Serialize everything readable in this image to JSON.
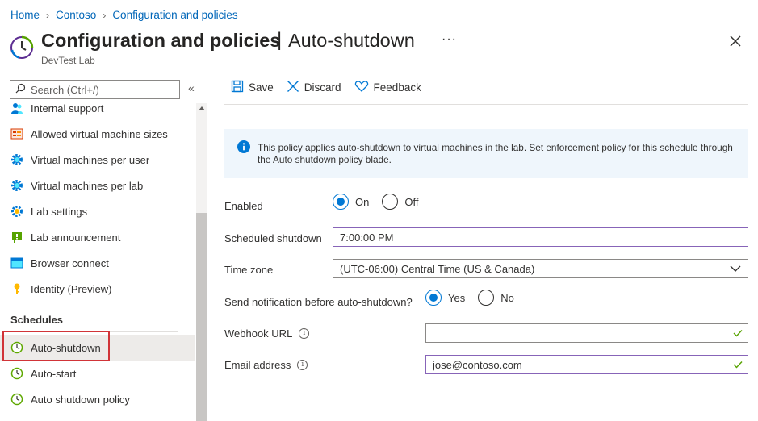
{
  "breadcrumb": [
    "Home",
    "Contoso",
    "Configuration and policies"
  ],
  "header": {
    "title": "Configuration and policies",
    "separator": "|",
    "subtitle": "Auto-shutdown",
    "resource_type": "DevTest Lab",
    "more": "···"
  },
  "sidebar": {
    "search_placeholder": "Search (Ctrl+/)",
    "collapse_glyph": "«",
    "items": [
      {
        "label": "Internal support",
        "icon": "support-icon"
      },
      {
        "label": "Allowed virtual machine sizes",
        "icon": "vm-sizes-icon"
      },
      {
        "label": "Virtual machines per user",
        "icon": "gear-icon"
      },
      {
        "label": "Virtual machines per lab",
        "icon": "gear-icon"
      },
      {
        "label": "Lab settings",
        "icon": "settings-icon"
      },
      {
        "label": "Lab announcement",
        "icon": "announcement-icon"
      },
      {
        "label": "Browser connect",
        "icon": "browser-icon"
      },
      {
        "label": "Identity (Preview)",
        "icon": "key-icon"
      }
    ],
    "section_header": "Schedules",
    "schedule_items": [
      {
        "label": "Auto-shutdown",
        "icon": "clock-icon",
        "active": true
      },
      {
        "label": "Auto-start",
        "icon": "clock-icon"
      },
      {
        "label": "Auto shutdown policy",
        "icon": "clock-icon"
      }
    ]
  },
  "toolbar": {
    "save": "Save",
    "discard": "Discard",
    "feedback": "Feedback"
  },
  "info_banner": "This policy applies auto-shutdown to virtual machines in the lab. Set enforcement policy for this schedule through the Auto shutdown policy blade.",
  "form": {
    "enabled_label": "Enabled",
    "enabled_options": [
      "On",
      "Off"
    ],
    "enabled_value": "On",
    "scheduled_label": "Scheduled shutdown",
    "scheduled_value": "7:00:00 PM",
    "timezone_label": "Time zone",
    "timezone_value": "(UTC-06:00) Central Time (US & Canada)",
    "notify_label": "Send notification before auto-shutdown?",
    "notify_options": [
      "Yes",
      "No"
    ],
    "notify_value": "Yes",
    "webhook_label": "Webhook URL",
    "webhook_value": "",
    "email_label": "Email address",
    "email_value": "jose@contoso.com"
  },
  "colors": {
    "link": "#0066b8",
    "accent": "#0078d4",
    "focus_border": "#8764b8",
    "valid_check": "#57a300",
    "highlight": "#d13438"
  }
}
